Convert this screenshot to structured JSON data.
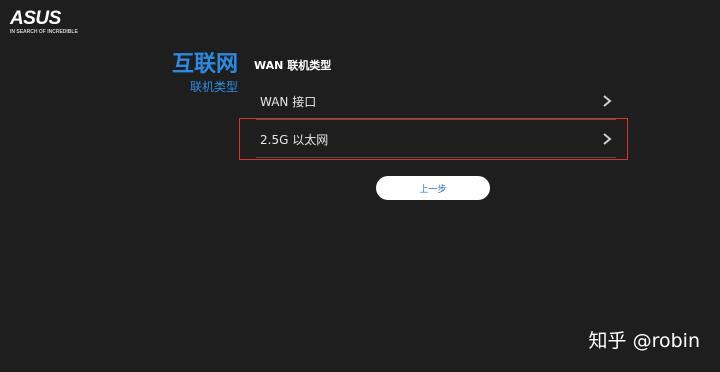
{
  "brand": {
    "logo_text": "ASUS",
    "slogan": "IN SEARCH OF INCREDIBLE"
  },
  "sidebar": {
    "title": "互联网",
    "subtitle": "联机类型"
  },
  "main": {
    "section_label": "WAN 联机类型",
    "options": [
      {
        "label": "WAN 接口"
      },
      {
        "label": "2.5G 以太网"
      }
    ],
    "back_label": "上一步"
  },
  "watermark": "知乎 @robin",
  "colors": {
    "accent": "#2b8be0",
    "highlight": "#d8342c",
    "background": "#1e1e1e"
  }
}
